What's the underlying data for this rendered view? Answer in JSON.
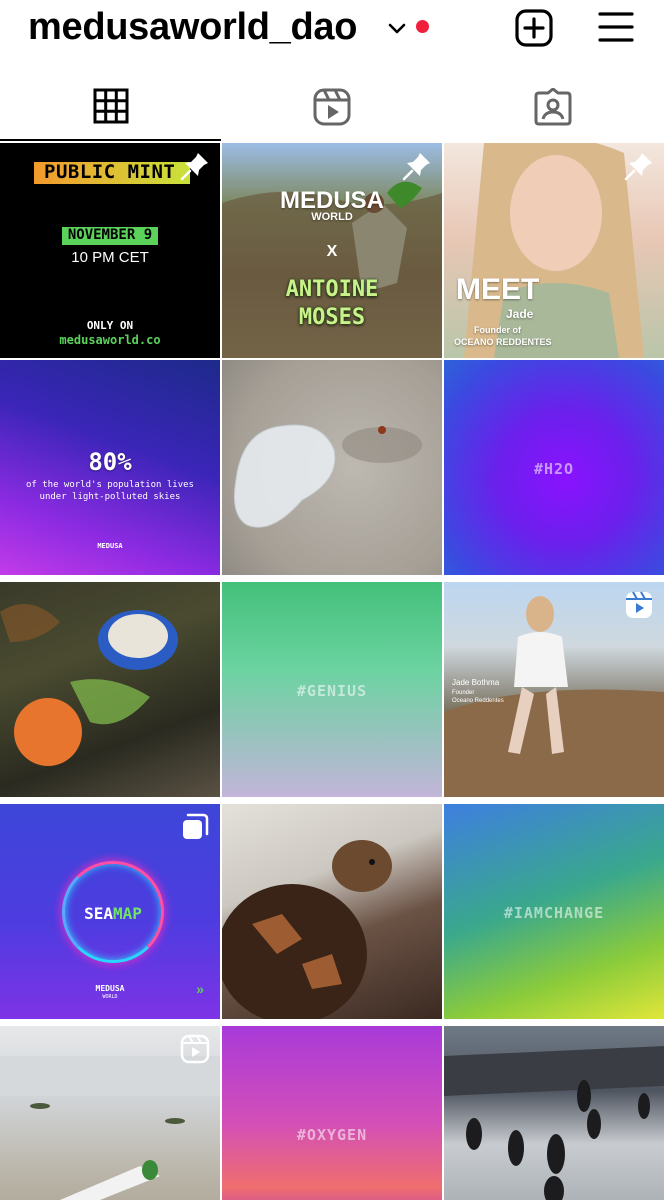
{
  "header": {
    "username": "medusaworld_dao",
    "notification_dot_color": "#f0203d",
    "icons": [
      "chevron-down-icon",
      "new-post-icon",
      "menu-icon"
    ]
  },
  "tabs": [
    {
      "name": "grid",
      "icon": "grid-icon",
      "selected": true
    },
    {
      "name": "reels",
      "icon": "reels-icon",
      "selected": false
    },
    {
      "name": "tagged",
      "icon": "tagged-icon",
      "selected": false
    }
  ],
  "posts": [
    {
      "badge": "pin-icon",
      "banner": "PUBLIC MINT",
      "date": "NOVEMBER 9",
      "time": "10 PM CET",
      "only_on": "ONLY ON",
      "site": "medusaworld.co"
    },
    {
      "badge": "pin-icon",
      "brand": "MEDUSA",
      "brand_sub": "WORLD",
      "x": "X",
      "name_line1": "ANTOINE",
      "name_line2": "MOSES"
    },
    {
      "badge": "pin-icon",
      "title": "MEET",
      "name": "Jade",
      "role": "Founder of",
      "org": "OCEANO REDDENTES"
    },
    {
      "stat": "80%",
      "line1": "of the world's population lives",
      "line2": "under light-polluted skies",
      "logo": "MEDUSA"
    },
    {
      "description": "plastic bag on sand"
    },
    {
      "hashtag": "#H2O"
    },
    {
      "description": "plastic waste on beach"
    },
    {
      "hashtag": "#GENIUS"
    },
    {
      "badge": "reels-icon",
      "person": "Jade Bothma",
      "role": "Founder",
      "org": "Oceano Reddentes"
    },
    {
      "badge": "carousel-icon",
      "sea": "SEA",
      "map": "MAP",
      "logo": "MEDUSA",
      "logo_sub": "WORLD",
      "arrows": "»"
    },
    {
      "description": "sea turtle"
    },
    {
      "hashtag": "#IAMCHANGE"
    },
    {
      "badge": "reels-icon",
      "description": "bottle on beach"
    },
    {
      "hashtag": "#OXYGEN"
    },
    {
      "description": "penguins on rocks"
    }
  ]
}
